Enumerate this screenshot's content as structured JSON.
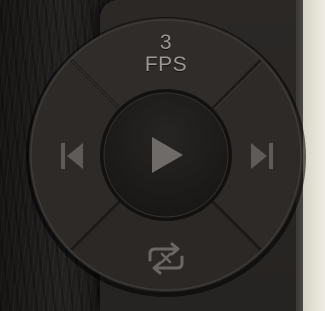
{
  "controller": {
    "fps": {
      "value": "3",
      "unit": "FPS"
    },
    "icons": {
      "previous": "skip-previous-icon",
      "play": "play-icon",
      "next": "skip-next-icon",
      "loop": "loop-toggle-icon"
    },
    "colors": {
      "face": "#2e2b29",
      "icon": "#6f6b68",
      "center": "#1f1d1c"
    }
  }
}
